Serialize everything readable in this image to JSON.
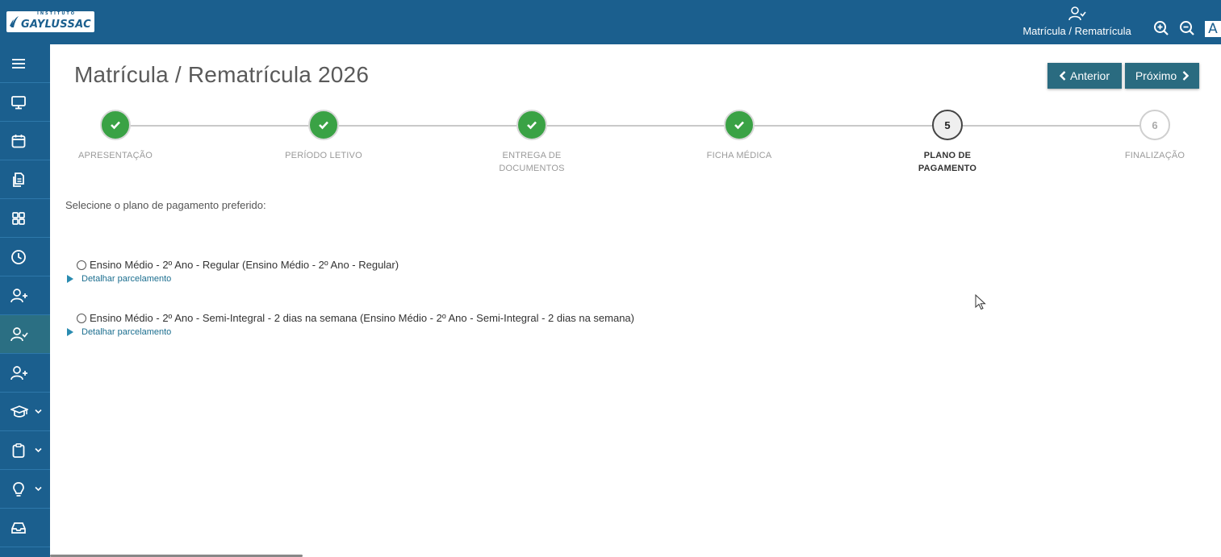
{
  "brand": {
    "logo_small": "INSTITUTO",
    "logo_text": "GAYLUSSAC"
  },
  "topbar": {
    "module_label": "Matrícula / Rematrícula",
    "tools": [
      "zoom-in-icon",
      "zoom-out-icon",
      "font-size-icon"
    ],
    "font_tool_glyph": "A"
  },
  "sidebar": {
    "items": [
      {
        "icon": "menu-icon",
        "active": false
      },
      {
        "icon": "monitor-icon",
        "active": false
      },
      {
        "icon": "calendar-icon",
        "active": false
      },
      {
        "icon": "documents-icon",
        "active": false
      },
      {
        "icon": "grid-icon",
        "active": false
      },
      {
        "icon": "clock-icon",
        "active": false
      },
      {
        "icon": "user-plus-icon",
        "active": false
      },
      {
        "icon": "user-check-icon",
        "active": true
      },
      {
        "icon": "user-plus-icon",
        "active": false
      },
      {
        "icon": "graduation-cap-icon",
        "active": false,
        "expandable": true
      },
      {
        "icon": "clipboard-icon",
        "active": false,
        "expandable": true
      },
      {
        "icon": "lightbulb-icon",
        "active": false,
        "expandable": true
      },
      {
        "icon": "inbox-icon",
        "active": false
      }
    ]
  },
  "main": {
    "title": "Matrícula / Rematrícula 2026",
    "prev_label": "Anterior",
    "next_label": "Próximo",
    "instructions": "Selecione o plano de pagamento preferido:"
  },
  "steps": [
    {
      "label_lines": [
        "APRESENTAÇÃO"
      ],
      "state": "done"
    },
    {
      "label_lines": [
        "PERÍODO LETIVO"
      ],
      "state": "done"
    },
    {
      "label_lines": [
        "ENTREGA DE",
        "DOCUMENTOS"
      ],
      "state": "done"
    },
    {
      "label_lines": [
        "FICHA MÉDICA"
      ],
      "state": "done"
    },
    {
      "label_lines": [
        "PLANO DE",
        "PAGAMENTO"
      ],
      "state": "current",
      "number": "5"
    },
    {
      "label_lines": [
        "FINALIZAÇÃO"
      ],
      "state": "todo",
      "number": "6"
    }
  ],
  "plans": [
    {
      "label": "Ensino Médio - 2º Ano - Regular (Ensino Médio - 2º Ano - Regular)",
      "detail": "Detalhar parcelamento",
      "selected": false
    },
    {
      "label": "Ensino Médio - 2º Ano - Semi-Integral - 2 dias na semana (Ensino Médio - 2º Ano - Semi-Integral - 2 dias na semana)",
      "detail": "Detalhar parcelamento",
      "selected": false
    }
  ],
  "colors": {
    "brand_blue": "#1b5f8e",
    "button_teal": "#2a6b80",
    "done_green": "#3aa245",
    "link_blue": "#1b6e8f"
  }
}
